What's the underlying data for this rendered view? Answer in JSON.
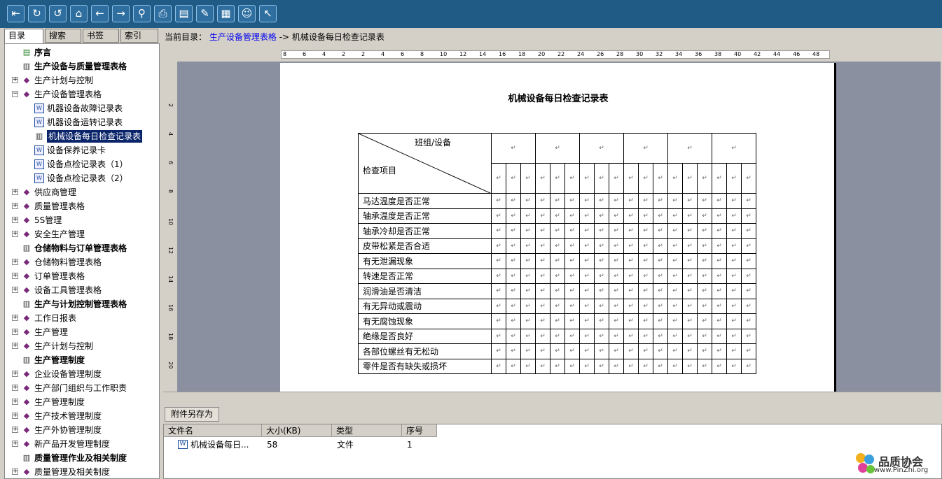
{
  "toolbar": {
    "buttons": [
      {
        "name": "exit-icon",
        "glyph": "⇤"
      },
      {
        "name": "refresh-icon",
        "glyph": "↻"
      },
      {
        "name": "undo-icon",
        "glyph": "↺"
      },
      {
        "name": "home-icon",
        "glyph": "⌂"
      },
      {
        "name": "back-icon",
        "glyph": "←"
      },
      {
        "name": "forward-icon",
        "glyph": "→"
      },
      {
        "name": "search-icon",
        "glyph": "⚲"
      },
      {
        "name": "print-icon",
        "glyph": "⎙"
      },
      {
        "name": "notes-icon",
        "glyph": "▤"
      },
      {
        "name": "edit-icon",
        "glyph": "✎"
      },
      {
        "name": "document-icon",
        "glyph": "▦"
      },
      {
        "name": "smiley-icon",
        "glyph": "☺"
      },
      {
        "name": "pointer-icon",
        "glyph": "↖"
      }
    ]
  },
  "tabs": [
    "目录",
    "搜索",
    "书签",
    "索引"
  ],
  "tree": [
    {
      "label": "序言",
      "icon": "pref",
      "level": 1,
      "bold": true,
      "exp": ""
    },
    {
      "label": "生产设备与质量管理表格",
      "icon": "open",
      "level": 1,
      "bold": true,
      "exp": ""
    },
    {
      "label": "生产计划与控制",
      "icon": "book",
      "level": 1,
      "bold": false,
      "exp": "+"
    },
    {
      "label": "生产设备管理表格",
      "icon": "book",
      "level": 1,
      "bold": false,
      "exp": "−"
    },
    {
      "label": "机器设备故障记录表",
      "icon": "doc",
      "level": 2,
      "bold": false,
      "exp": ""
    },
    {
      "label": "机器设备运转记录表",
      "icon": "doc",
      "level": 2,
      "bold": false,
      "exp": ""
    },
    {
      "label": "机械设备每日检查记录表",
      "icon": "open",
      "level": 2,
      "bold": false,
      "exp": "",
      "selected": true
    },
    {
      "label": "设备保养记录卡",
      "icon": "doc",
      "level": 2,
      "bold": false,
      "exp": ""
    },
    {
      "label": "设备点检记录表（1）",
      "icon": "doc",
      "level": 2,
      "bold": false,
      "exp": ""
    },
    {
      "label": "设备点检记录表（2）",
      "icon": "doc",
      "level": 2,
      "bold": false,
      "exp": ""
    },
    {
      "label": "供应商管理",
      "icon": "book",
      "level": 1,
      "bold": false,
      "exp": "+"
    },
    {
      "label": "质量管理表格",
      "icon": "book",
      "level": 1,
      "bold": false,
      "exp": "+"
    },
    {
      "label": "5S管理",
      "icon": "book",
      "level": 1,
      "bold": false,
      "exp": "+"
    },
    {
      "label": "安全生产管理",
      "icon": "book",
      "level": 1,
      "bold": false,
      "exp": "+"
    },
    {
      "label": "仓储物料与订单管理表格",
      "icon": "open",
      "level": 1,
      "bold": true,
      "exp": ""
    },
    {
      "label": "仓储物料管理表格",
      "icon": "book",
      "level": 1,
      "bold": false,
      "exp": "+"
    },
    {
      "label": "订单管理表格",
      "icon": "book",
      "level": 1,
      "bold": false,
      "exp": "+"
    },
    {
      "label": "设备工具管理表格",
      "icon": "book",
      "level": 1,
      "bold": false,
      "exp": "+"
    },
    {
      "label": "生产与计划控制管理表格",
      "icon": "open",
      "level": 1,
      "bold": true,
      "exp": ""
    },
    {
      "label": "工作日报表",
      "icon": "book",
      "level": 1,
      "bold": false,
      "exp": "+"
    },
    {
      "label": "生产管理",
      "icon": "book",
      "level": 1,
      "bold": false,
      "exp": "+"
    },
    {
      "label": "生产计划与控制",
      "icon": "book",
      "level": 1,
      "bold": false,
      "exp": "+"
    },
    {
      "label": "生产管理制度",
      "icon": "open",
      "level": 1,
      "bold": true,
      "exp": ""
    },
    {
      "label": "企业设备管理制度",
      "icon": "book",
      "level": 1,
      "bold": false,
      "exp": "+"
    },
    {
      "label": "生产部门组织与工作职责",
      "icon": "book",
      "level": 1,
      "bold": false,
      "exp": "+"
    },
    {
      "label": "生产管理制度",
      "icon": "book",
      "level": 1,
      "bold": false,
      "exp": "+"
    },
    {
      "label": "生产技术管理制度",
      "icon": "book",
      "level": 1,
      "bold": false,
      "exp": "+"
    },
    {
      "label": "生产外协管理制度",
      "icon": "book",
      "level": 1,
      "bold": false,
      "exp": "+"
    },
    {
      "label": "新产品开发管理制度",
      "icon": "book",
      "level": 1,
      "bold": false,
      "exp": "+"
    },
    {
      "label": "质量管理作业及相关制度",
      "icon": "open",
      "level": 1,
      "bold": true,
      "exp": ""
    },
    {
      "label": "质量管理及相关制度",
      "icon": "book",
      "level": 1,
      "bold": false,
      "exp": "+"
    }
  ],
  "path": {
    "prefix": "当前目录：",
    "link": "生产设备管理表格",
    "suffix": " -> 机械设备每日检查记录表"
  },
  "ruler": {
    "ticks": [
      "8",
      "6",
      "4",
      "2",
      "2",
      "4",
      "6",
      "8",
      "10",
      "12",
      "14",
      "16",
      "18",
      "20",
      "22",
      "24",
      "26",
      "28",
      "30",
      "32",
      "34",
      "36",
      "38",
      "40",
      "42",
      "44",
      "46",
      "48"
    ]
  },
  "vruler": {
    "ticks": [
      "2",
      "4",
      "6",
      "8",
      "10",
      "12",
      "14",
      "16",
      "18",
      "20"
    ]
  },
  "document": {
    "title": "机械设备每日检查记录表",
    "header_top": "班组/设备",
    "header_bottom": "检查项目",
    "items": [
      "马达温度是否正常",
      "轴承温度是否正常",
      "轴承冷却是否正常",
      "皮带松紧是否合适",
      "有无泄漏现象",
      "转速是否正常",
      "润滑油是否清洁",
      "有无异动或震动",
      "有无腐蚀现象",
      "绝缘是否良好",
      "各部位螺丝有无松动",
      "零件是否有缺失或损坏"
    ]
  },
  "attachments": {
    "save_button": "附件另存为",
    "columns": [
      "文件名",
      "大小(KB)",
      "类型",
      "序号"
    ],
    "rows": [
      {
        "name": "机械设备每日...",
        "size": "58",
        "type": "文件",
        "index": "1"
      }
    ]
  },
  "logo": {
    "name": "品质协会",
    "url": "www.PinZhi.org"
  }
}
